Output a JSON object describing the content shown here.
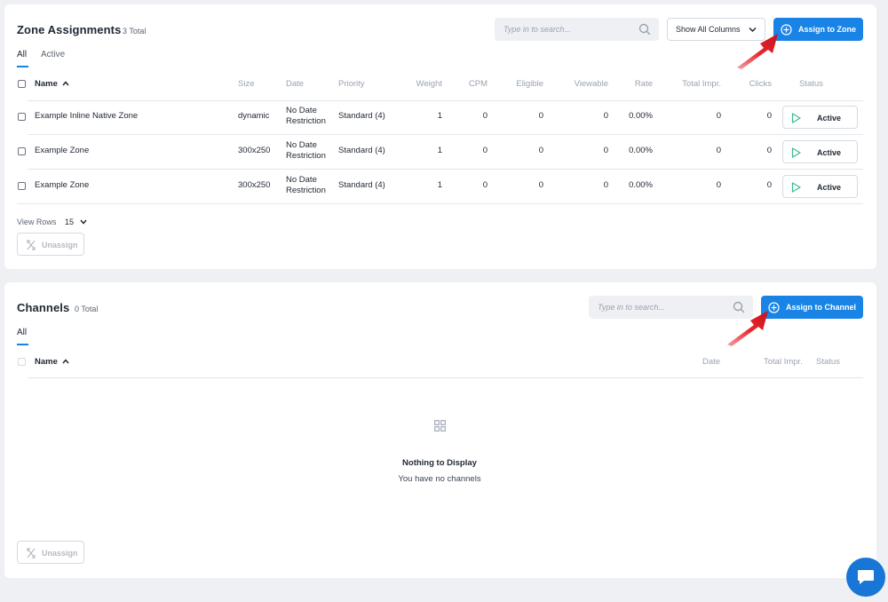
{
  "zones": {
    "title": "Zone Assignments",
    "total": "3 Total",
    "search_placeholder": "Type in to search...",
    "show_columns_label": "Show All Columns",
    "assign_label": "Assign to Zone",
    "tabs": [
      {
        "label": "All"
      },
      {
        "label": "Active"
      }
    ],
    "columns": {
      "name": "Name",
      "size": "Size",
      "date": "Date",
      "priority": "Priority",
      "weight": "Weight",
      "cpm": "CPM",
      "eligible": "Eligible",
      "viewable": "Viewable",
      "rate": "Rate",
      "total_impr": "Total Impr.",
      "clicks": "Clicks",
      "status": "Status"
    },
    "rows": [
      {
        "name": "Example Inline Native Zone",
        "size": "dynamic",
        "date_line1": "No Date",
        "date_line2": "Restriction",
        "priority": "Standard (4)",
        "weight": "1",
        "cpm": "0",
        "eligible": "0",
        "viewable": "0",
        "rate": "0.00%",
        "total_impr": "0",
        "clicks": "0",
        "status": "Active"
      },
      {
        "name": "Example Zone",
        "size": "300x250",
        "date_line1": "No Date",
        "date_line2": "Restriction",
        "priority": "Standard (4)",
        "weight": "1",
        "cpm": "0",
        "eligible": "0",
        "viewable": "0",
        "rate": "0.00%",
        "total_impr": "0",
        "clicks": "0",
        "status": "Active"
      },
      {
        "name": "Example Zone",
        "size": "300x250",
        "date_line1": "No Date",
        "date_line2": "Restriction",
        "priority": "Standard (4)",
        "weight": "1",
        "cpm": "0",
        "eligible": "0",
        "viewable": "0",
        "rate": "0.00%",
        "total_impr": "0",
        "clicks": "0",
        "status": "Active"
      }
    ],
    "view_rows_label": "View Rows",
    "view_rows_value": "15",
    "unassign_label": "Unassign"
  },
  "channels": {
    "title": "Channels",
    "total": "0 Total",
    "search_placeholder": "Type in to search...",
    "assign_label": "Assign to Channel",
    "tabs": [
      {
        "label": "All"
      }
    ],
    "columns": {
      "name": "Name",
      "date": "Date",
      "total_impr": "Total Impr.",
      "status": "Status"
    },
    "empty_title": "Nothing to Display",
    "empty_subtitle": "You have no channels",
    "unassign_label": "Unassign"
  },
  "colors": {
    "accent": "#1a83e6",
    "active_icon": "#3dbf8a",
    "arrow": "#e8262d"
  },
  "icons": {
    "search": "search-icon",
    "chevron": "chevron-down-icon",
    "add": "plus-circle-icon",
    "play": "play-icon",
    "unassign": "unassign-icon",
    "empty": "grid-icon",
    "chat": "chat-icon"
  }
}
